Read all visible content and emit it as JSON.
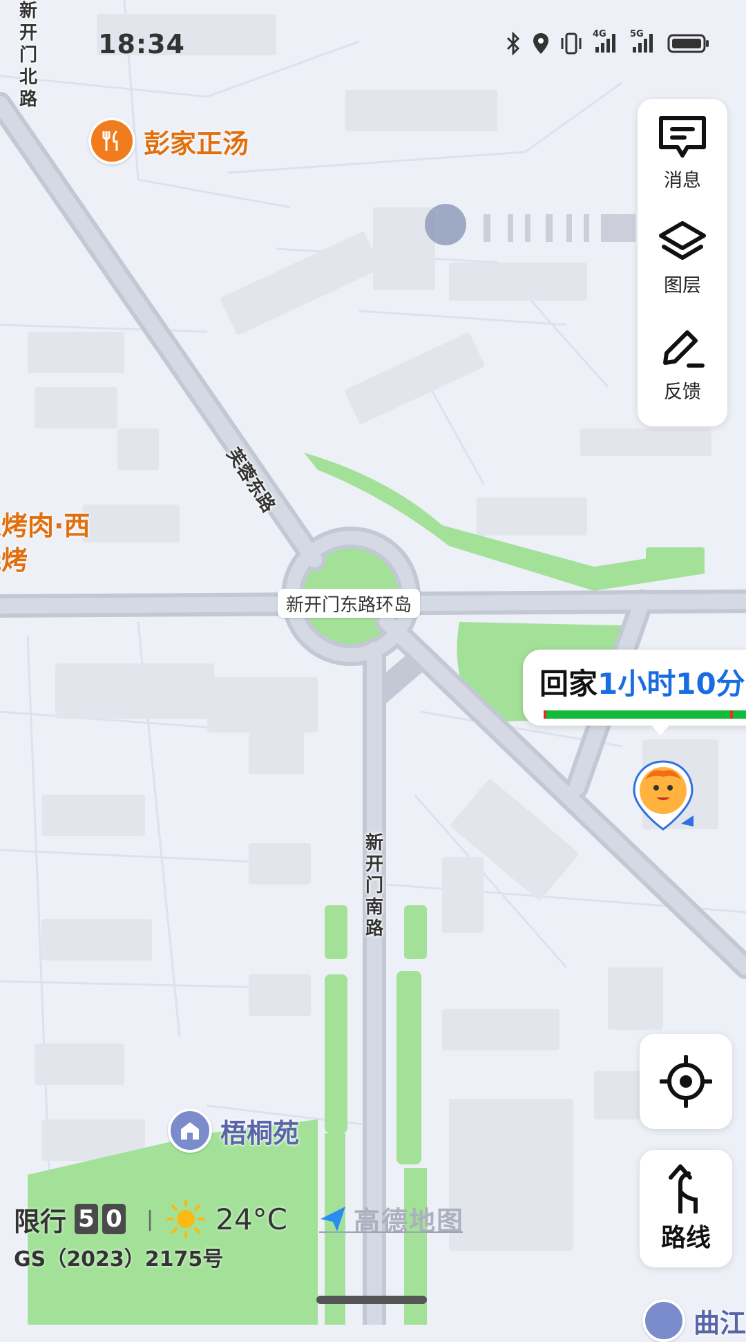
{
  "status_bar": {
    "time": "18:34",
    "network_1": "4G",
    "network_2": "5G",
    "icons": [
      "bluetooth-icon",
      "location-icon",
      "vibrate-icon",
      "signal-icon",
      "signal-icon",
      "battery-icon"
    ]
  },
  "side_panel": {
    "message_label": "消息",
    "layers_label": "图层",
    "feedback_label": "反馈"
  },
  "map": {
    "poi_restaurant": "彭家正汤",
    "poi_bbq_line1": "家烤肉·西",
    "poi_bbq_line2": "烧烤",
    "poi_residential": "梧桐苑",
    "poi_partial": "曲江",
    "road_north": "新开门北路",
    "road_diagonal": "芙蓉东路",
    "road_south": "新开门南路",
    "roundabout": "新开门东路环岛"
  },
  "eta_card": {
    "destination": "回家",
    "duration": "1小时10分"
  },
  "controls": {
    "locate_icon": "locate-icon",
    "route_label": "路线"
  },
  "footer": {
    "restriction_label": "限行",
    "restriction_digit_1": "5",
    "restriction_digit_2": "0",
    "separator": "|",
    "weather_icon": "sun-icon",
    "temperature": "24°C",
    "brand": "高德地图",
    "license": "GS（2023）2175号"
  },
  "colors": {
    "map_bg": "#eef0f7",
    "road": "#c2c8d4",
    "green": "#a3e199",
    "poi_orange": "#f07c1e",
    "eta_blue": "#1a6de0",
    "progress_green": "#14b93c"
  }
}
